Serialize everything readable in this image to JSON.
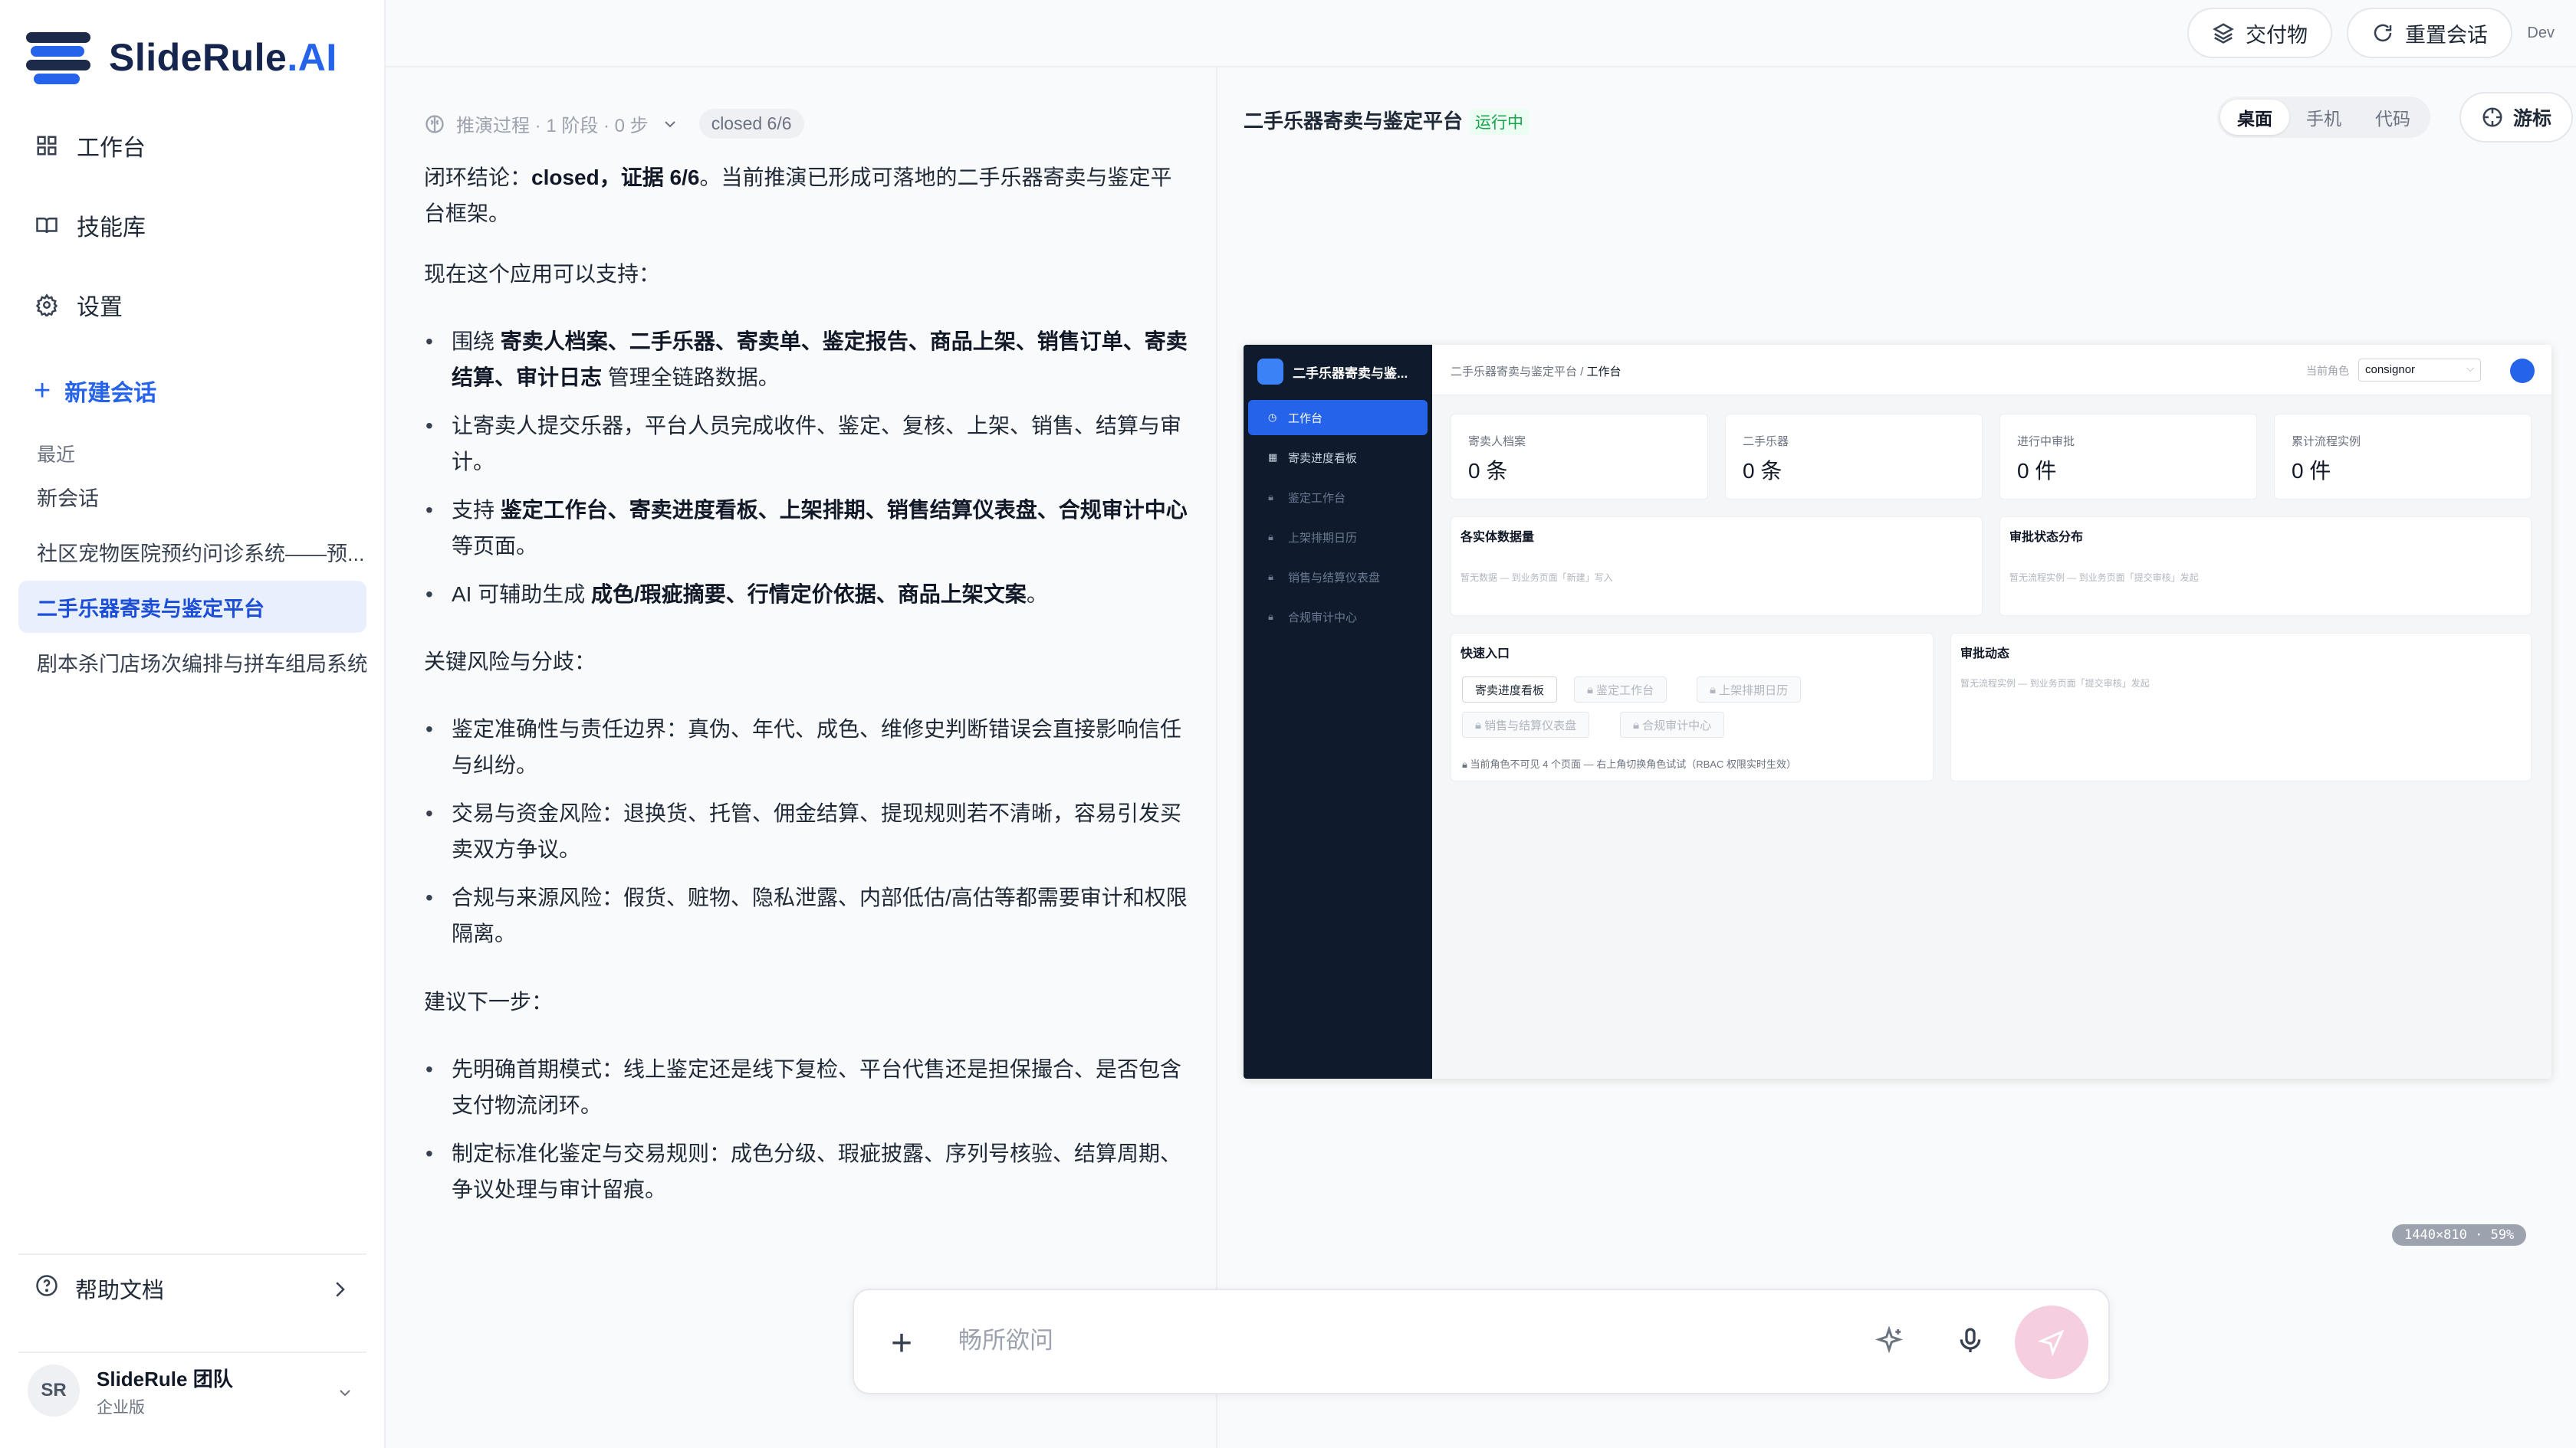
{
  "brand": {
    "name": "SlideRule",
    "suffix": ".AI"
  },
  "sidebar": {
    "nav": [
      {
        "label": "工作台",
        "icon": "grid-icon"
      },
      {
        "label": "技能库",
        "icon": "book-icon"
      },
      {
        "label": "设置",
        "icon": "gear-icon"
      }
    ],
    "new_chat": "新建会话",
    "recent_label": "最近",
    "recent": [
      "新会话",
      "社区宠物医院预约问诊系统——预...",
      "二手乐器寄卖与鉴定平台",
      "剧本杀门店场次编排与拼车组局系统"
    ],
    "help": "帮助文档",
    "team": {
      "initials": "SR",
      "name": "SlideRule 团队",
      "plan": "企业版"
    }
  },
  "topbar": {
    "deliverables": "交付物",
    "reset": "重置会话",
    "dev": "Dev"
  },
  "chat": {
    "trace": "推演过程 · 1 阶段 · 0 步",
    "trace_badge": "closed 6/6",
    "conclusion_pre": "闭环结论：",
    "conclusion_bold": "closed，证据 6/6",
    "conclusion_post": "。当前推演已形成可落地的二手乐器寄卖与鉴定平台框架。",
    "support_heading": "现在这个应用可以支持：",
    "b1_pre": "围绕 ",
    "b1_bold": "寄卖人档案、二手乐器、寄卖单、鉴定报告、商品上架、销售订单、寄卖结算、审计日志",
    "b1_post": " 管理全链路数据。",
    "b2": "让寄卖人提交乐器，平台人员完成收件、鉴定、复核、上架、销售、结算与审计。",
    "b3_pre": "支持 ",
    "b3_bold": "鉴定工作台、寄卖进度看板、上架排期、销售结算仪表盘、合规审计中心",
    "b3_post": " 等页面。",
    "b4_pre": "AI 可辅助生成 ",
    "b4_bold": "成色/瑕疵摘要、行情定价依据、商品上架文案",
    "b4_post": "。",
    "risk_heading": "关键风险与分歧：",
    "r1": "鉴定准确性与责任边界：真伪、年代、成色、维修史判断错误会直接影响信任与纠纷。",
    "r2": "交易与资金风险：退换货、托管、佣金结算、提现规则若不清晰，容易引发买卖双方争议。",
    "r3": "合规与来源风险：假货、赃物、隐私泄露、内部低估/高估等都需要审计和权限隔离。",
    "next_heading": "建议下一步：",
    "n1": "先明确首期模式：线上鉴定还是线下复检、平台代售还是担保撮合、是否包含支付物流闭环。",
    "n2": "制定标准化鉴定与交易规则：成色分级、瑕疵披露、序列号核验、结算周期、争议处理与审计留痕。"
  },
  "preview": {
    "title": "二手乐器寄卖与鉴定平台",
    "status": "运行中",
    "modes": [
      "桌面",
      "手机",
      "代码"
    ],
    "active_mode": "桌面",
    "cursor_label": "游标",
    "resolution": "1440×810 · 59%"
  },
  "miniapp": {
    "brand": "二手乐器寄卖与鉴...",
    "nav": [
      "工作台",
      "寄卖进度看板",
      "鉴定工作台",
      "上架排期日历",
      "销售与结算仪表盘",
      "合规审计中心"
    ],
    "breadcrumb_root": "二手乐器寄卖与鉴定平台",
    "breadcrumb_sep": "/",
    "breadcrumb_current": "工作台",
    "role_label": "当前角色",
    "role_value": "consignor",
    "stats": [
      {
        "label": "寄卖人档案",
        "value": "0 条"
      },
      {
        "label": "二手乐器",
        "value": "0 条"
      },
      {
        "label": "进行中审批",
        "value": "0 件"
      },
      {
        "label": "累计流程实例",
        "value": "0 件"
      }
    ],
    "panel_entities": {
      "title": "各实体数据量",
      "empty": "暂无数据 — 到业务页面「新建」写入"
    },
    "panel_approval": {
      "title": "审批状态分布",
      "empty": "暂无流程实例 — 到业务页面「提交审核」发起"
    },
    "panel_quick": {
      "title": "快速入口",
      "chips": [
        "寄卖进度看板",
        "鉴定工作台",
        "上架排期日历",
        "销售与结算仪表盘",
        "合规审计中心"
      ],
      "note": "当前角色不可见 4 个页面 — 右上角切换角色试试（RBAC 权限实时生效）"
    },
    "panel_activity": {
      "title": "审批动态",
      "empty": "暂无流程实例 — 到业务页面「提交审核」发起"
    }
  },
  "composer": {
    "placeholder": "畅所欲问"
  },
  "colors": {
    "accent": "#2563eb",
    "sidebar_dark": "#0f1b2d",
    "running": "#16a34a",
    "send": "#f5cfe0"
  }
}
